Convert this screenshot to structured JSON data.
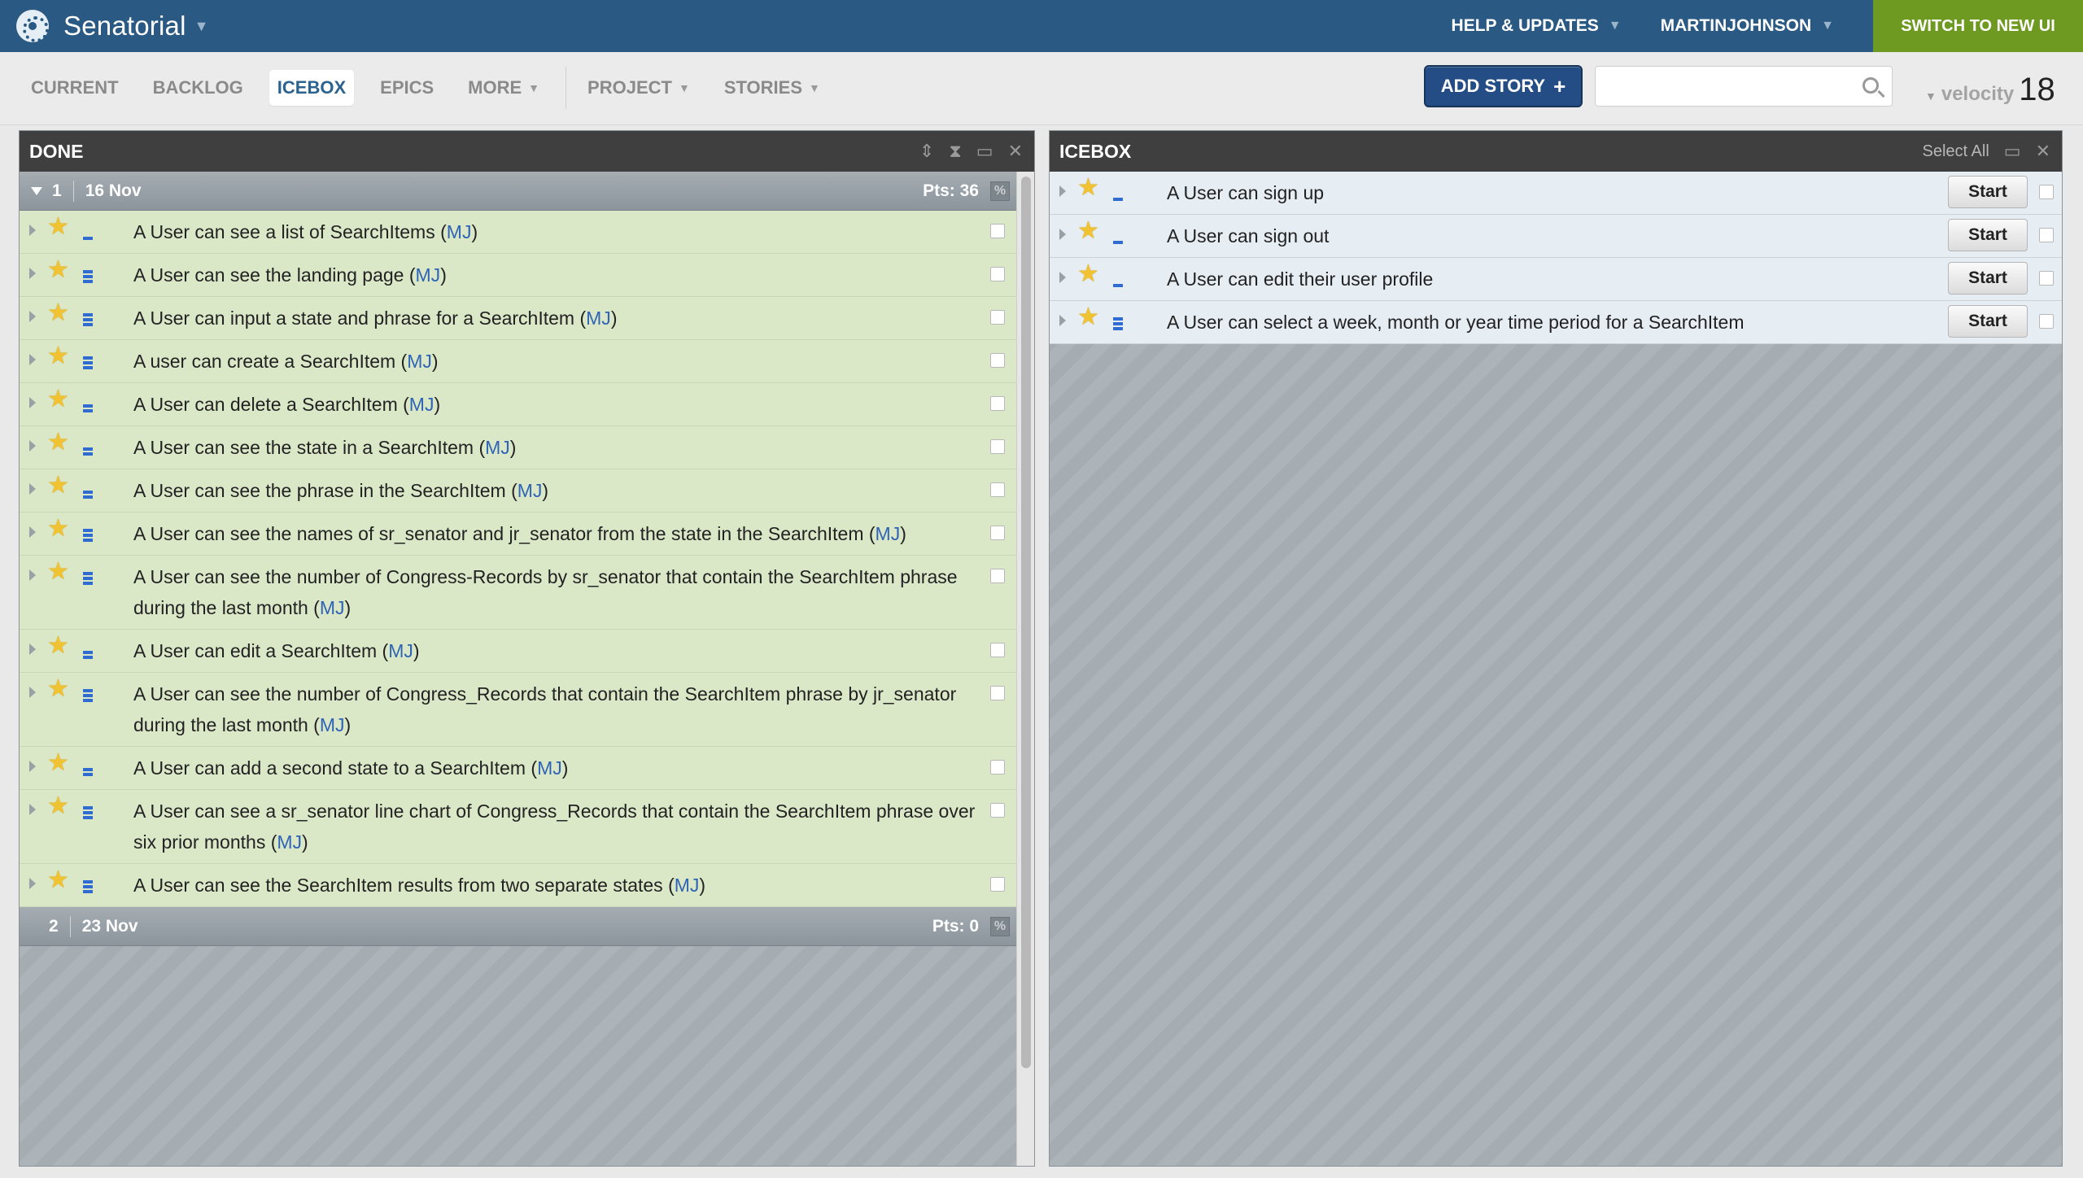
{
  "topbar": {
    "project_name": "Senatorial",
    "help_label": "HELP & UPDATES",
    "user_label": "MARTINJOHNSON",
    "switch_label": "SWITCH TO NEW UI"
  },
  "nav": {
    "tabs": [
      {
        "label": "CURRENT"
      },
      {
        "label": "BACKLOG"
      },
      {
        "label": "ICEBOX"
      },
      {
        "label": "EPICS"
      },
      {
        "label": "MORE"
      },
      {
        "label": "PROJECT"
      },
      {
        "label": "STORIES"
      }
    ],
    "active_tab": "ICEBOX",
    "add_story_label": "ADD STORY",
    "add_story_plus": "+",
    "search_placeholder": "",
    "velocity_label": "velocity",
    "velocity_value": "18"
  },
  "done_panel": {
    "title": "DONE",
    "iterations": [
      {
        "number": "1",
        "date": "16 Nov",
        "points": "Pts: 36",
        "pct": "%"
      },
      {
        "number": "2",
        "date": "23 Nov",
        "points": "Pts: 0",
        "pct": "%"
      }
    ],
    "stories": [
      {
        "text": "A User can see a list of SearchItems (",
        "owner": "MJ",
        "tail": ")"
      },
      {
        "text": "A User can see the landing page (",
        "owner": "MJ",
        "tail": ")"
      },
      {
        "text": "A User can input a state and phrase for a SearchItem (",
        "owner": "MJ",
        "tail": ")"
      },
      {
        "text": "A user can create a SearchItem (",
        "owner": "MJ",
        "tail": ")"
      },
      {
        "text": "A User can delete a SearchItem (",
        "owner": "MJ",
        "tail": ")"
      },
      {
        "text": "A User can see the state in a SearchItem (",
        "owner": "MJ",
        "tail": ")"
      },
      {
        "text": "A User can see the phrase in the SearchItem (",
        "owner": "MJ",
        "tail": ")"
      },
      {
        "text": "A User can see the names of sr_senator and jr_senator from the state in the SearchItem (",
        "owner": "MJ",
        "tail": ")"
      },
      {
        "text": "A User can see the number of Congress-Records by sr_senator that contain the SearchItem phrase during the last month (",
        "owner": "MJ",
        "tail": ")"
      },
      {
        "text": "A User can edit a SearchItem (",
        "owner": "MJ",
        "tail": ")"
      },
      {
        "text": "A User can see the number of Congress_Records that contain the SearchItem phrase by jr_senator during the last month (",
        "owner": "MJ",
        "tail": ")"
      },
      {
        "text": "A User can add a second state to a SearchItem (",
        "owner": "MJ",
        "tail": ")"
      },
      {
        "text": "A User can see a sr_senator line chart of Congress_Records that contain the SearchItem phrase over six prior months (",
        "owner": "MJ",
        "tail": ")"
      },
      {
        "text": "A User can see the SearchItem results from two separate states (",
        "owner": "MJ",
        "tail": ")"
      }
    ]
  },
  "icebox_panel": {
    "title": "ICEBOX",
    "select_all_label": "Select All",
    "start_label": "Start",
    "stories": [
      {
        "text": "A User can sign up"
      },
      {
        "text": "A User can sign out"
      },
      {
        "text": "A User can edit their user profile"
      },
      {
        "text": "A User can select a week, month or year time period for a SearchItem"
      }
    ]
  },
  "colors": {
    "topbar": "#2a5a83",
    "switch_button": "#6e9a21",
    "accepted_story": "#dbe8c8",
    "icebox_story": "#e6edf3",
    "add_story_button": "#234d84"
  }
}
